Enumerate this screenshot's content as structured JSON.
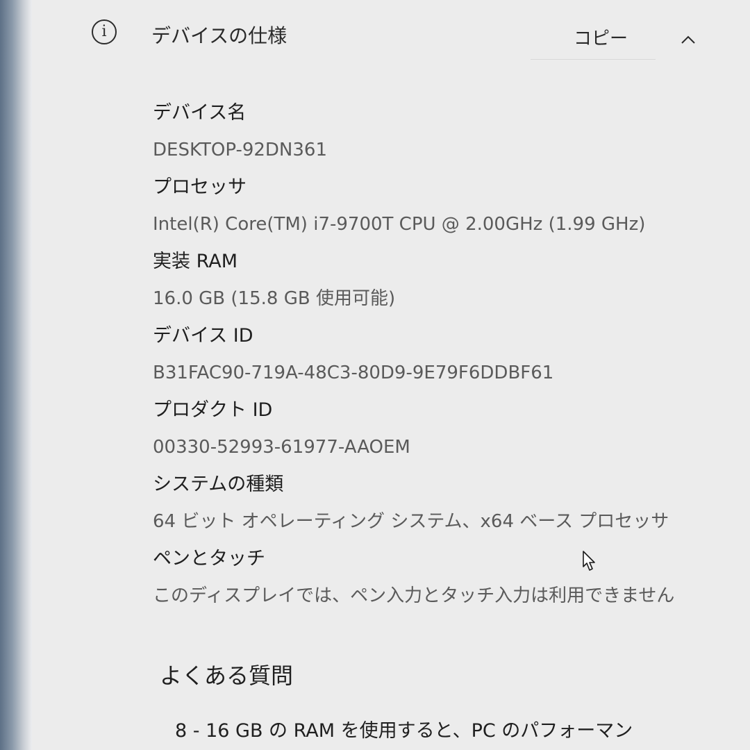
{
  "header": {
    "title": "デバイスの仕様",
    "copy_label": "コピー",
    "icon": "info-icon",
    "expand_icon": "chevron-up-icon"
  },
  "specs": [
    {
      "label": "デバイス名",
      "value": "DESKTOP-92DN361"
    },
    {
      "label": "プロセッサ",
      "value": "Intel(R) Core(TM) i7-9700T CPU @ 2.00GHz (1.99 GHz)"
    },
    {
      "label": "実装 RAM",
      "value": "16.0 GB (15.8 GB 使用可能)"
    },
    {
      "label": "デバイス ID",
      "value": "B31FAC90-719A-48C3-80D9-9E79F6DDBF61"
    },
    {
      "label": "プロダクト ID",
      "value": "00330-52993-61977-AAOEM"
    },
    {
      "label": "システムの種類",
      "value": "64 ビット オペレーティング システム、x64 ベース プロセッサ"
    },
    {
      "label": "ペンとタッチ",
      "value": "このディスプレイでは、ペン入力とタッチ入力は利用できません"
    }
  ],
  "faq": {
    "heading": "よくある質問",
    "first_question": "8 - 16 GB の RAM を使用すると、PC のパフォーマン"
  },
  "colors": {
    "panel_bg": "#ececec",
    "label_text": "#1f1f1f",
    "value_text": "#5a5a5a"
  }
}
